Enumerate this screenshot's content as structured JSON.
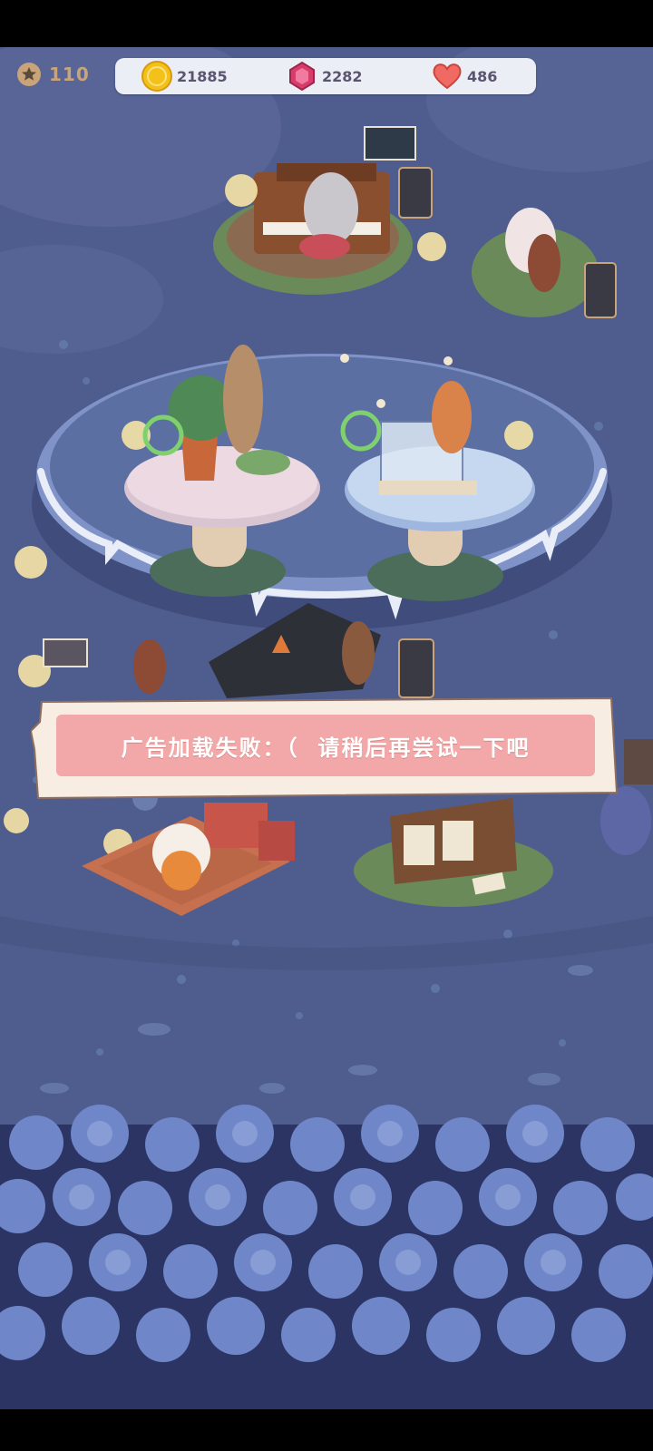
{
  "hud": {
    "level": "110",
    "coins": "21885",
    "gems": "2282",
    "hearts": "486"
  },
  "toast": {
    "message": "广告加载失败：（  请稍后再尝试一下吧"
  },
  "colors": {
    "night_bg": "#4f5d8e",
    "hud_bg": "#eceef5",
    "toast_bg": "#f2a8a8",
    "coin": "#f4c11a",
    "gem": "#d93c6a",
    "heart": "#f06a63"
  },
  "icons": [
    "star-icon",
    "coin-icon",
    "gem-icon",
    "heart-icon"
  ]
}
